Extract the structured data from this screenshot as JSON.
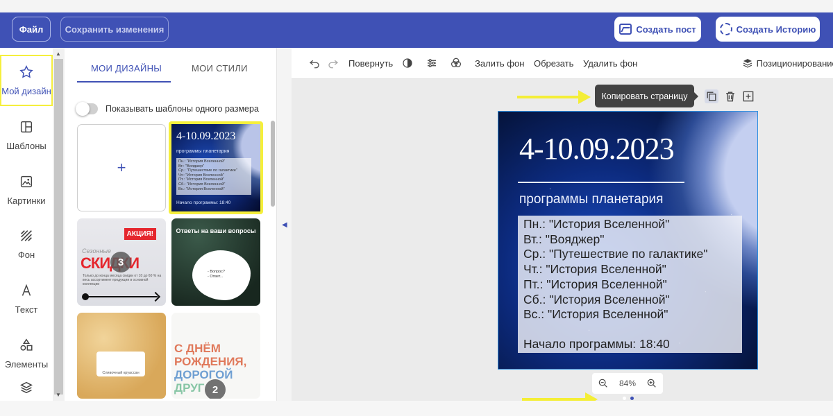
{
  "header": {
    "file_label": "Файл",
    "save_label": "Сохранить изменения",
    "create_post_label": "Создать пост",
    "create_story_label": "Создать Историю"
  },
  "sidebar": {
    "items": [
      {
        "label": "Мой дизайн",
        "icon": "star-icon"
      },
      {
        "label": "Шаблоны",
        "icon": "templates-icon"
      },
      {
        "label": "Картинки",
        "icon": "image-icon"
      },
      {
        "label": "Фон",
        "icon": "background-icon"
      },
      {
        "label": "Текст",
        "icon": "text-icon"
      },
      {
        "label": "Элементы",
        "icon": "shapes-icon"
      }
    ]
  },
  "panel": {
    "tab_designs": "МОИ ДИЗАЙНЫ",
    "tab_styles": "МОИ СТИЛИ",
    "toggle_label": "Показывать шаблоны одного размера",
    "new_symbol": "+",
    "selected_thumb": {
      "date": "4-10.09.2023",
      "subtitle": "программы планетария",
      "lines": [
        "Пн.: \"История Вселенной\"",
        "Вт.: \"Вояджер\"",
        "Ср.: \"Путешествие по галактике\"",
        "Чт.: \"История Вселенной\"",
        "Пт.: \"История Вселенной\"",
        "Сб.: \"История Вселенной\"",
        "Вс.: \"История Вселенной\""
      ],
      "start": "Начало программы: 18:40"
    },
    "sale_thumb": {
      "badge_text": "АКЦИЯ!",
      "kicker": "Сезонные",
      "big": "СКИДКИ",
      "small": "Только до конца месяца скидки от 10 до 60 % на весь ассортимент продукции в основной коллекции",
      "count": "3"
    },
    "qa_thumb": {
      "title": "Ответы на ваши вопросы",
      "q1": "- Вопрос?",
      "q2": "- Ответ..."
    },
    "croissant_thumb": {
      "caption": "Сливочный круассан"
    },
    "bday_thumb": {
      "l1": "С ДНЁМ",
      "l2": "РОЖДЕНИЯ,",
      "l3": "ДОРОГОЙ",
      "l4": "ДРУГ",
      "count": "2"
    }
  },
  "toolbar": {
    "rotate": "Повернуть",
    "fill_bg": "Залить фон",
    "crop": "Обрезать",
    "remove_bg": "Удалить фон",
    "positioning": "Позиционирование"
  },
  "canvas": {
    "tooltip": "Копировать страницу",
    "zoom": "84%",
    "page": {
      "date": "4-10.09.2023",
      "subtitle": "программы планетария",
      "lines": [
        "Пн.: \"История Вселенной\"",
        "Вт.: \"Вояджер\"",
        "Ср.: \"Путешествие по галактике\"",
        "Чт.: \"История Вселенной\"",
        "Пт.: \"История Вселенной\"",
        "Сб.: \"История Вселенной\"",
        "Вс.: \"История Вселенной\""
      ],
      "start": "Начало программы: 18:40"
    }
  },
  "colors": {
    "header_bg": "#3f51b5",
    "highlight": "#f5ef3c",
    "accent": "#3f51b5"
  }
}
